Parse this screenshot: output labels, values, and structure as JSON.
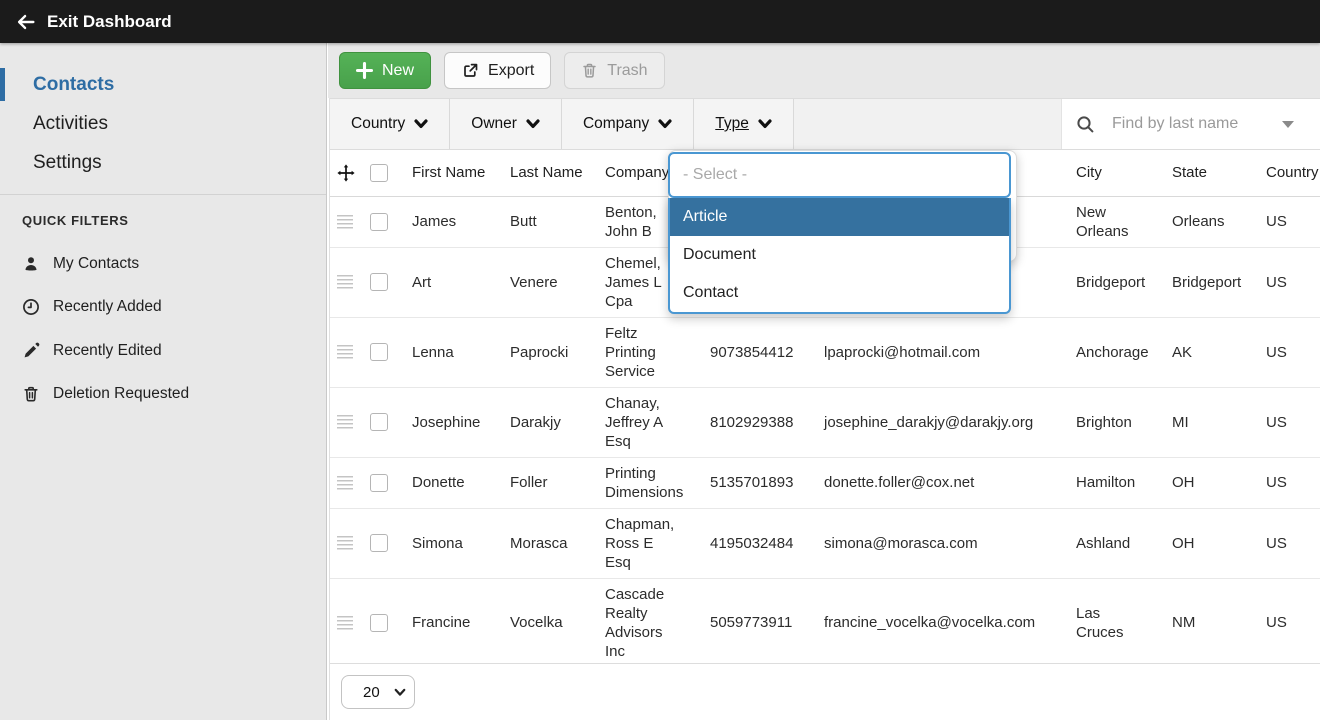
{
  "topbar": {
    "back_label": "Exit Dashboard"
  },
  "sidebar": {
    "nav": [
      {
        "label": "Contacts",
        "active": true
      },
      {
        "label": "Activities",
        "active": false
      },
      {
        "label": "Settings",
        "active": false
      }
    ],
    "quick_filters_title": "QUICK FILTERS",
    "quick_filters": [
      {
        "icon": "person-icon",
        "label": "My Contacts"
      },
      {
        "icon": "clock-icon",
        "label": "Recently Added"
      },
      {
        "icon": "pencil-icon",
        "label": "Recently Edited"
      },
      {
        "icon": "trash-icon",
        "label": "Deletion Requested"
      }
    ]
  },
  "toolbar": {
    "new_label": "New",
    "export_label": "Export",
    "trash_label": "Trash"
  },
  "filters": {
    "dropdowns": [
      "Country",
      "Owner",
      "Company",
      "Type"
    ],
    "active": "Type",
    "search_placeholder": "Find by last name"
  },
  "type_dropdown": {
    "placeholder": "- Select -",
    "options": [
      "Article",
      "Document",
      "Contact"
    ],
    "highlighted": "Article"
  },
  "table": {
    "headers": [
      "First Name",
      "Last Name",
      "Company",
      "",
      "",
      "City",
      "State",
      "Country"
    ],
    "rows": [
      {
        "first": "James",
        "last": "Butt",
        "company": "Benton, John B",
        "phone": "",
        "email": "",
        "city": "New Orleans",
        "state": "Orleans",
        "country": "US"
      },
      {
        "first": "Art",
        "last": "Venere",
        "company": "Chemel, James L Cpa",
        "phone": "",
        "email": "",
        "city": "Bridgeport",
        "state": "Bridgeport",
        "country": "US"
      },
      {
        "first": "Lenna",
        "last": "Paprocki",
        "company": "Feltz Printing Service",
        "phone": "9073854412",
        "email": "lpaprocki@hotmail.com",
        "city": "Anchorage",
        "state": "AK",
        "country": "US"
      },
      {
        "first": "Josephine",
        "last": "Darakjy",
        "company": "Chanay, Jeffrey A Esq",
        "phone": "8102929388",
        "email": "josephine_darakjy@darakjy.org",
        "city": "Brighton",
        "state": "MI",
        "country": "US"
      },
      {
        "first": "Donette",
        "last": "Foller",
        "company": "Printing Dimensions",
        "phone": "5135701893",
        "email": "donette.foller@cox.net",
        "city": "Hamilton",
        "state": "OH",
        "country": "US"
      },
      {
        "first": "Simona",
        "last": "Morasca",
        "company": "Chapman, Ross E Esq",
        "phone": "4195032484",
        "email": "simona@morasca.com",
        "city": "Ashland",
        "state": "OH",
        "country": "US"
      },
      {
        "first": "Francine",
        "last": "Vocelka",
        "company": "Cascade Realty Advisors Inc",
        "phone": "5059773911",
        "email": "francine_vocelka@vocelka.com",
        "city": "Las Cruces",
        "state": "NM",
        "country": "US"
      }
    ]
  },
  "pagination": {
    "page_size": "20"
  },
  "colors": {
    "topbar_bg": "#1b1b1b",
    "sidebar_bg": "#e8e8e8",
    "accent_blue": "#2e6da4",
    "dropdown_border_blue": "#4a97d2",
    "option_highlight_blue": "#35719f",
    "new_button_green": "#4caf50"
  }
}
